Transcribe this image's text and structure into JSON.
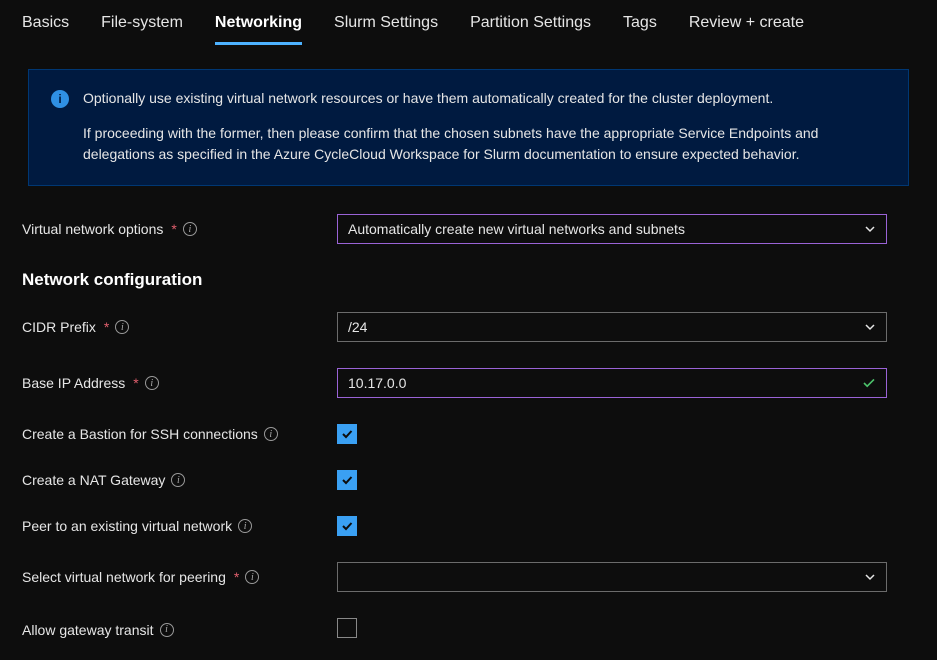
{
  "tabs": [
    {
      "label": "Basics"
    },
    {
      "label": "File-system"
    },
    {
      "label": "Networking",
      "active": true
    },
    {
      "label": "Slurm Settings"
    },
    {
      "label": "Partition Settings"
    },
    {
      "label": "Tags"
    },
    {
      "label": "Review + create"
    }
  ],
  "banner": {
    "p1": "Optionally use existing virtual network resources or have them automatically created for the cluster deployment.",
    "p2": "If proceeding with the former, then please confirm that the chosen subnets have the appropriate Service Endpoints and delegations as specified in the Azure CycleCloud Workspace for Slurm documentation to ensure expected behavior."
  },
  "fields": {
    "vnet_options": {
      "label": "Virtual network options",
      "value": "Automatically create new virtual networks and subnets"
    },
    "section_title": "Network configuration",
    "cidr": {
      "label": "CIDR Prefix",
      "value": "/24"
    },
    "base_ip": {
      "label": "Base IP Address",
      "value": "10.17.0.0"
    },
    "bastion": {
      "label": "Create a Bastion for SSH connections",
      "checked": true
    },
    "nat": {
      "label": "Create a NAT Gateway",
      "checked": true
    },
    "peer": {
      "label": "Peer to an existing virtual network",
      "checked": true
    },
    "peer_vnet": {
      "label": "Select virtual network for peering",
      "value": ""
    },
    "gw_transit": {
      "label": "Allow gateway transit",
      "checked": false
    }
  }
}
